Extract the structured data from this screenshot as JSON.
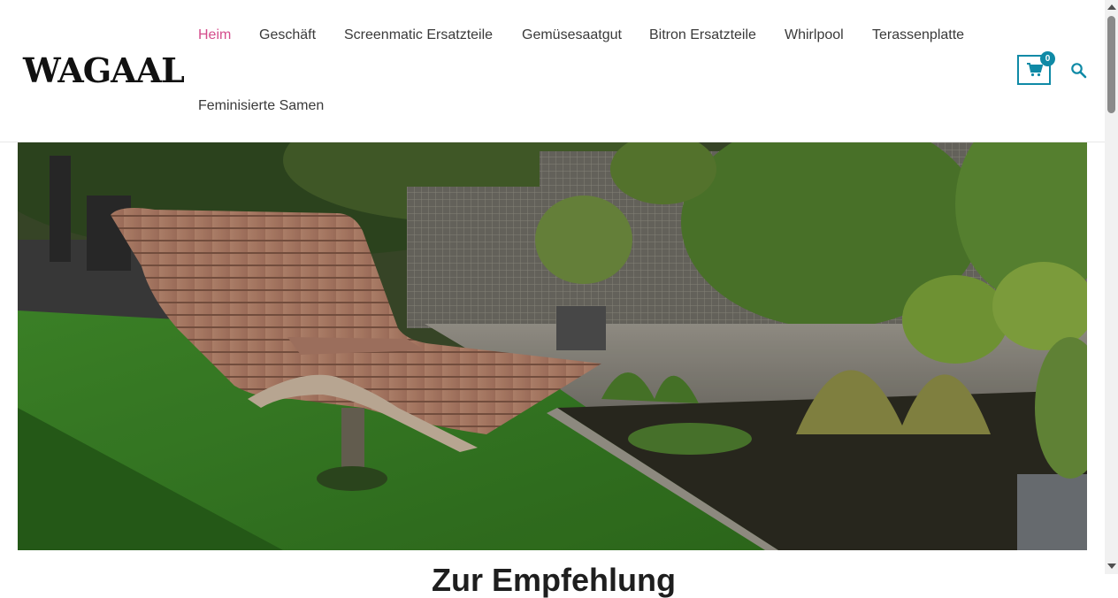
{
  "site": {
    "logo": "WAGAAL"
  },
  "nav": {
    "items": [
      {
        "label": "Heim",
        "active": true
      },
      {
        "label": "Geschäft"
      },
      {
        "label": "Screenmatic Ersatzteile"
      },
      {
        "label": "Gemüsesaatgut"
      },
      {
        "label": "Bitron Ersatzteile"
      },
      {
        "label": "Whirlpool"
      },
      {
        "label": "Terassenplatte"
      },
      {
        "label": "Feminisierte Samen"
      }
    ]
  },
  "cart": {
    "count": "0",
    "icon": "shopping-cart-icon"
  },
  "search": {
    "icon": "search-icon"
  },
  "hero": {
    "image": "wooden-lounger-garden-photo"
  },
  "content": {
    "heading": "Zur Empfehlung"
  },
  "colors": {
    "accent": "#0f8aa6",
    "active_nav": "#d44d8c",
    "text": "#3a3a3a"
  }
}
